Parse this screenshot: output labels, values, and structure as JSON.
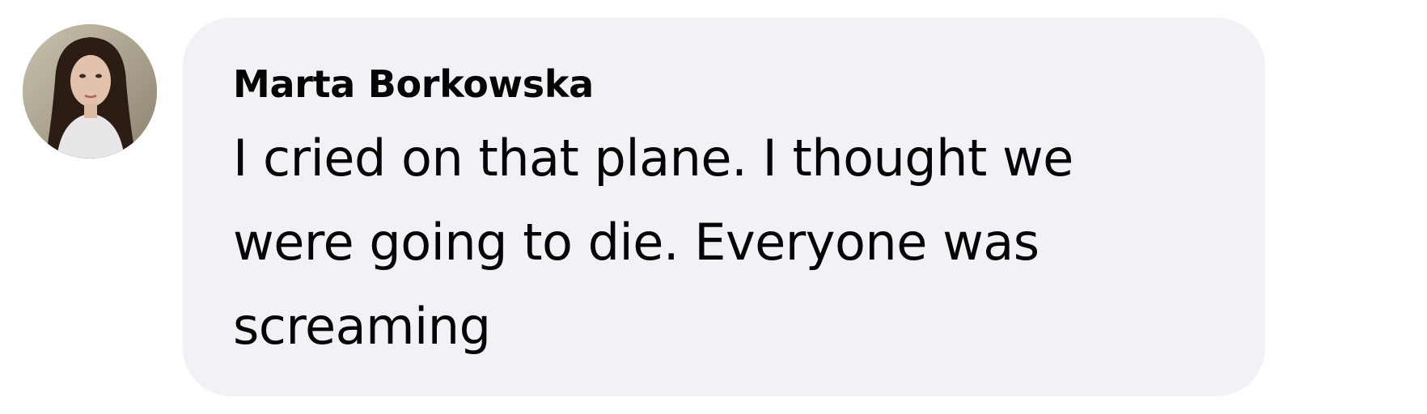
{
  "comment": {
    "author": "Marta Borkowska",
    "text": "I cried on that plane. I thought we were going to die. Everyone was screaming",
    "avatar_icon": "profile-photo"
  },
  "colors": {
    "bubble_background": "#f0f2f5",
    "text": "#050505"
  }
}
